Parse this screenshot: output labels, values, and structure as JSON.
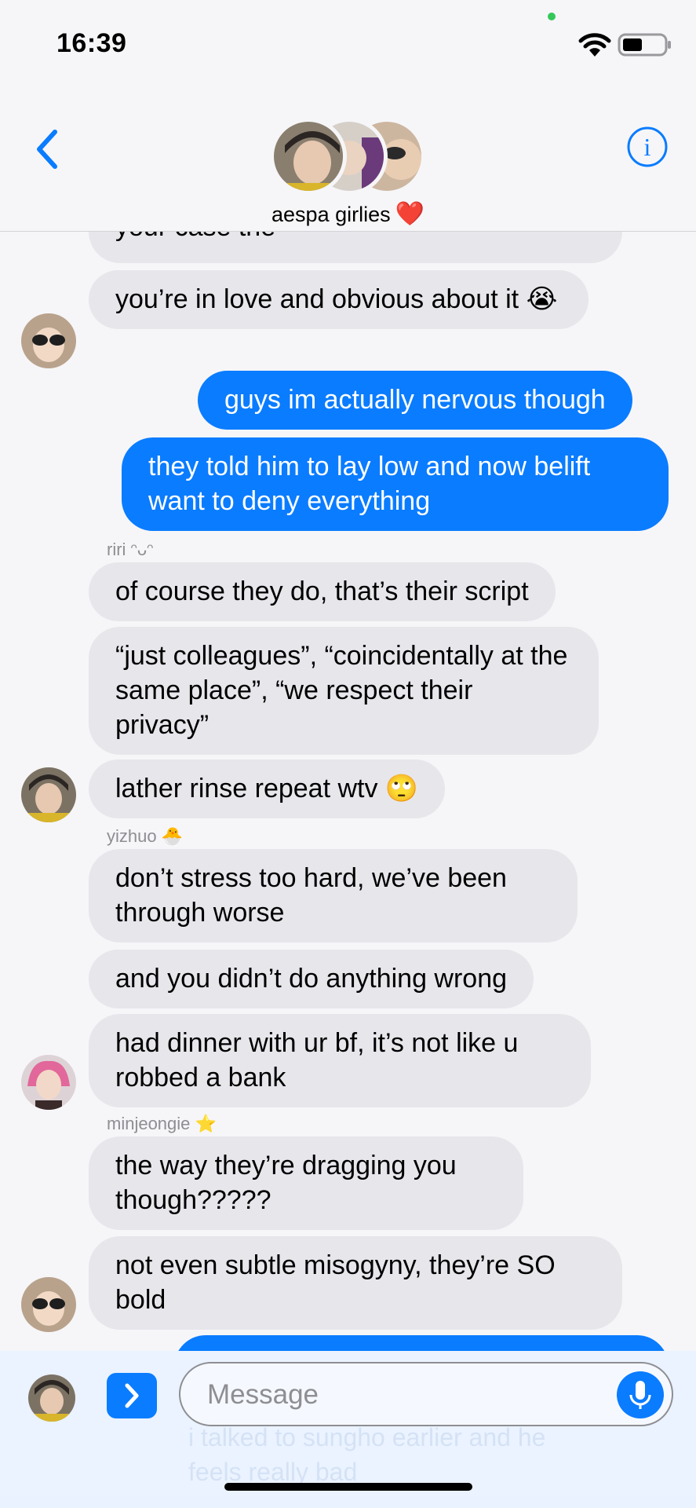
{
  "status": {
    "time": "16:39"
  },
  "header": {
    "title": "aespa girlies",
    "title_emoji": "❤️"
  },
  "messages": {
    "m0": "your case the",
    "m1": "you’re in love and obvious about it 😭",
    "m2": "guys im actually nervous though",
    "m3": "they told him to lay low and now belift want to deny everything",
    "s1": "riri ᵔᴗᵔ",
    "m4": "of course they do, that’s their script",
    "m5": "“just colleagues”, “coincidentally at the same place”, “we respect their privacy”",
    "m6": "lather rinse repeat wtv 🙄",
    "s2": "yizhuo 🐣",
    "m7": "don’t stress too hard, we’ve been through worse",
    "m8": "and you didn’t do anything wrong",
    "m9": "had dinner with ur bf, it’s not like u robbed a bank",
    "s3": "minjeongie ⭐",
    "m10": "the way they’re dragging you though?????",
    "m11": "not even subtle misogyny, they’re SO bold"
  },
  "composer": {
    "placeholder": "Message",
    "ghost_text_1": "i talked to sungho earlier and he",
    "ghost_text_2": "feels really bad"
  },
  "colors": {
    "accent": "#0a7cff",
    "incoming": "#e7e6eb",
    "background": "#f6f6f8"
  }
}
